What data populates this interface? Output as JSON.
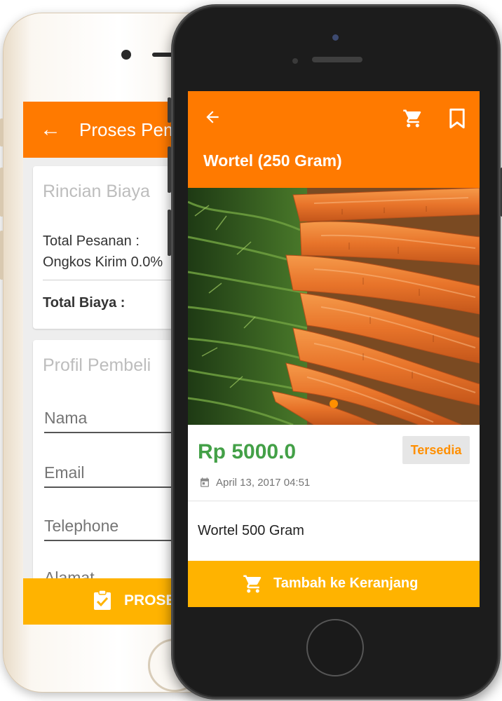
{
  "back_screen": {
    "app_bar": {
      "title": "Proses Pembelian"
    },
    "cost_card": {
      "heading": "Rincian Biaya",
      "total_order": "Total Pesanan :",
      "shipping": "Ongkos Kirim 0.0%",
      "total_cost": "Total Biaya :"
    },
    "buyer_card": {
      "heading": "Profil Pembeli",
      "fields": [
        {
          "placeholder": "Nama"
        },
        {
          "placeholder": "Email"
        },
        {
          "placeholder": "Telephone"
        },
        {
          "placeholder": "Alamat"
        }
      ]
    },
    "bottom_button": {
      "label": "PROSES",
      "icon": "clipboard-check-icon"
    }
  },
  "front_screen": {
    "app_bar": {
      "title": "Wortel (250 Gram)",
      "icons": [
        "back-arrow-icon",
        "cart-icon",
        "bookmark-icon"
      ]
    },
    "product": {
      "image": "carrots-photo",
      "price": "Rp 5000.0",
      "status": "Tersedia",
      "date": "April 13, 2017 04:51",
      "description": "Wortel 500 Gram"
    },
    "add_to_cart": {
      "label": "Tambah ke Keranjang",
      "icon": "cart-icon"
    }
  },
  "colors": {
    "app_bar": "#ff7a00",
    "action_button": "#ffb300",
    "price": "#43a047",
    "status": "#ff8f00"
  }
}
